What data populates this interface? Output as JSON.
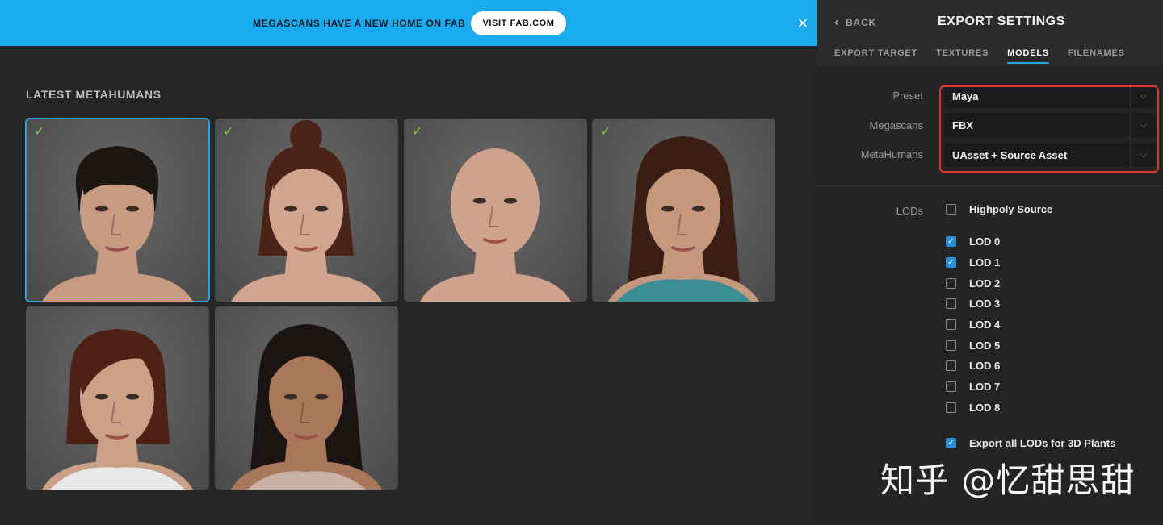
{
  "banner": {
    "text": "MEGASCANS HAVE A NEW HOME ON FAB",
    "button_label": "VISIT FAB.COM",
    "close_icon": "×"
  },
  "main": {
    "section_title": "LATEST METAHUMANS",
    "cards": [
      {
        "checked": true,
        "selected": true,
        "skin": "#c79a82",
        "hair": "#1c1613",
        "style": "bangs"
      },
      {
        "checked": true,
        "selected": false,
        "skin": "#d0a48d",
        "hair": "#4a2418",
        "style": "bun"
      },
      {
        "checked": true,
        "selected": false,
        "skin": "#cfa28e",
        "hair": "#cfa28e",
        "style": "bald"
      },
      {
        "checked": true,
        "selected": false,
        "skin": "#c5977d",
        "hair": "#3a1d13",
        "style": "long"
      },
      {
        "checked": false,
        "selected": false,
        "skin": "#caa087",
        "hair": "#4d2115",
        "style": "bob"
      },
      {
        "checked": false,
        "selected": false,
        "skin": "#a9775a",
        "hair": "#1a1412",
        "style": "curly"
      }
    ],
    "check_icon": "✓"
  },
  "panel": {
    "back_label": "BACK",
    "back_icon": "‹",
    "title": "EXPORT SETTINGS",
    "tabs": [
      {
        "label": "EXPORT TARGET",
        "active": false
      },
      {
        "label": "TEXTURES",
        "active": false
      },
      {
        "label": "MODELS",
        "active": true
      },
      {
        "label": "FILENAMES",
        "active": false
      }
    ],
    "fields": {
      "preset": {
        "label": "Preset",
        "value": "Maya"
      },
      "megascans": {
        "label": "Megascans",
        "value": "FBX"
      },
      "metahumans": {
        "label": "MetaHumans",
        "value": "UAsset + Source Asset"
      }
    },
    "dropdown_icon": "⌵",
    "lods_label": "LODs",
    "checkboxes": [
      {
        "label": "Highpoly Source",
        "checked": false
      },
      {
        "label": "LOD 0",
        "checked": true
      },
      {
        "label": "LOD 1",
        "checked": true
      },
      {
        "label": "LOD 2",
        "checked": false
      },
      {
        "label": "LOD 3",
        "checked": false
      },
      {
        "label": "LOD 4",
        "checked": false
      },
      {
        "label": "LOD 5",
        "checked": false
      },
      {
        "label": "LOD 6",
        "checked": false
      },
      {
        "label": "LOD 7",
        "checked": false
      },
      {
        "label": "LOD 8",
        "checked": false
      },
      {
        "label": "Export all LODs for 3D Plants",
        "checked": true
      }
    ],
    "highlight_color": "#e0352b",
    "accent_color": "#2aa3e0"
  },
  "watermark": "知乎 @忆甜思甜"
}
